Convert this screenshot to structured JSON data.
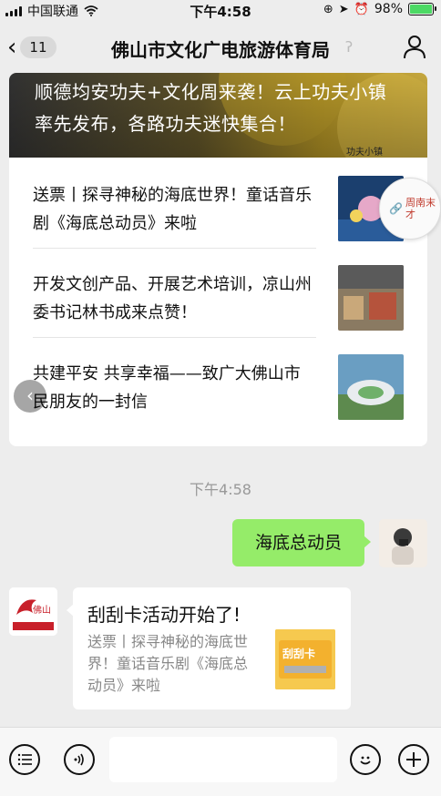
{
  "status_bar": {
    "carrier": "中国联通",
    "time": "下午4:58",
    "battery": "98%",
    "battery_level": 0.98
  },
  "nav": {
    "back_badge": "11",
    "title": "佛山市文化广电旅游体育局"
  },
  "articles": {
    "hero_title": "顺德均安功夫+文化周来袭！云上功夫小镇率先发布，各路功夫迷快集合！",
    "hero_seal": "功夫小镇",
    "items": [
      {
        "title": "送票丨探寻神秘的海底世界！童话音乐剧《海底总动员》来啦"
      },
      {
        "title": "开发文创产品、开展艺术培训，凉山州委书记林书成来点赞！"
      },
      {
        "title": "共建平安 共享幸福——致广大佛山市民朋友的一封信"
      }
    ]
  },
  "float_badge": {
    "text": "周南末才"
  },
  "chat": {
    "timestamp": "下午4:58",
    "outgoing": "海底总动员",
    "incoming": {
      "title": "刮刮卡活动开始了!",
      "desc": "送票丨探寻神秘的海底世界！童话音乐剧《海底总动员》来啦",
      "thumb_label": "刮刮卡"
    }
  },
  "input": {
    "placeholder": ""
  },
  "colors": {
    "accent_green": "#95ec69",
    "background": "#ededed",
    "battery_green": "#4cd964"
  }
}
